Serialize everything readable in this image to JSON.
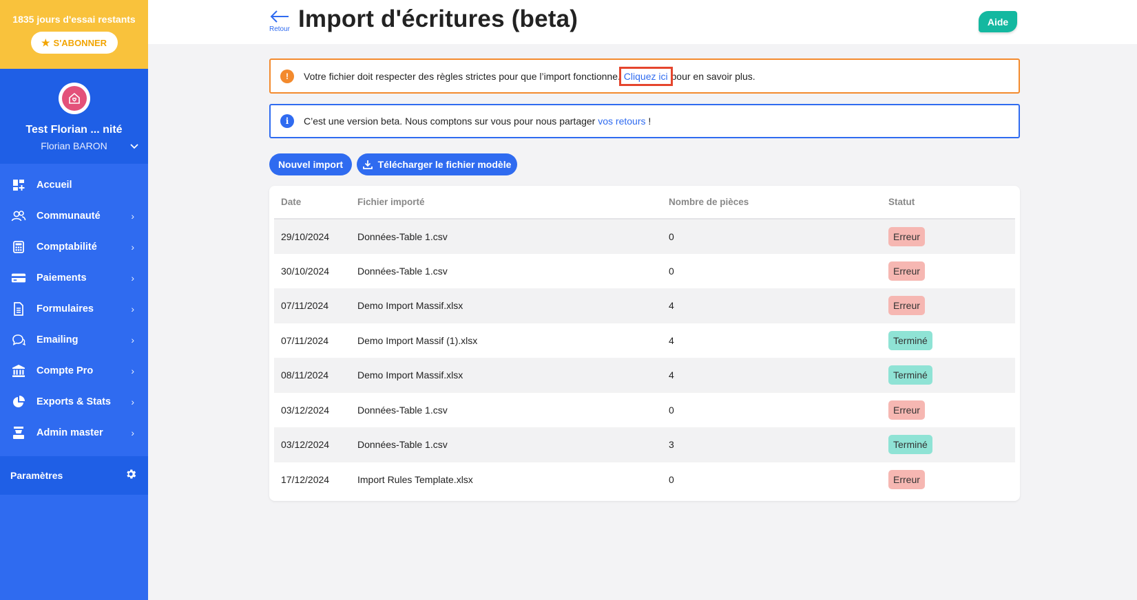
{
  "colors": {
    "primary": "#2f6bf0",
    "trial_bg": "#f9c23c",
    "help": "#14b8a0",
    "warning_border": "#f38a2d",
    "error_badge": "#f6b7b2",
    "success_badge": "#8fe3d5"
  },
  "sidebar": {
    "trial_text": "1835 jours d'essai restants",
    "subscribe_label": "S'ABONNER",
    "org_name": "Test Florian ... nité",
    "user_name": "Florian BARON",
    "items": [
      {
        "label": "Accueil",
        "icon": "dashboard-icon",
        "has_chevron": false
      },
      {
        "label": "Communauté",
        "icon": "people-icon",
        "has_chevron": true
      },
      {
        "label": "Comptabilité",
        "icon": "calculator-icon",
        "has_chevron": true
      },
      {
        "label": "Paiements",
        "icon": "credit-card-icon",
        "has_chevron": true
      },
      {
        "label": "Formulaires",
        "icon": "document-icon",
        "has_chevron": true
      },
      {
        "label": "Emailing",
        "icon": "chat-icon",
        "has_chevron": true
      },
      {
        "label": "Compte Pro",
        "icon": "bank-icon",
        "has_chevron": true
      },
      {
        "label": "Exports & Stats",
        "icon": "pie-chart-icon",
        "has_chevron": true
      },
      {
        "label": "Admin master",
        "icon": "admin-icon",
        "has_chevron": true
      }
    ],
    "settings_label": "Paramètres"
  },
  "header": {
    "back_label": "Retour",
    "title": "Import d'écritures (beta)",
    "help_label": "Aide"
  },
  "alerts": {
    "warning": {
      "icon": "!",
      "text_before": "Votre fichier doit respecter des règles strictes pour que l’import fonctionne. ",
      "link": "Cliquez ici",
      "text_after": " pour en savoir plus."
    },
    "info": {
      "icon": "i",
      "text_before": "C’est une version beta. Nous comptons sur vous pour nous partager ",
      "link": "vos retours",
      "text_after": " !"
    }
  },
  "actions": {
    "new_import": "Nouvel import",
    "download_template": "Télécharger le fichier modèle"
  },
  "table": {
    "headers": [
      "Date",
      "Fichier importé",
      "Nombre de pièces",
      "Statut"
    ],
    "rows": [
      {
        "date": "29/10/2024",
        "file": "Données-Table 1.csv",
        "pieces": "0",
        "status": "Erreur"
      },
      {
        "date": "30/10/2024",
        "file": "Données-Table 1.csv",
        "pieces": "0",
        "status": "Erreur"
      },
      {
        "date": "07/11/2024",
        "file": "Demo Import Massif.xlsx",
        "pieces": "4",
        "status": "Erreur"
      },
      {
        "date": "07/11/2024",
        "file": "Demo Import Massif (1).xlsx",
        "pieces": "4",
        "status": "Terminé"
      },
      {
        "date": "08/11/2024",
        "file": "Demo Import Massif.xlsx",
        "pieces": "4",
        "status": "Terminé"
      },
      {
        "date": "03/12/2024",
        "file": "Données-Table 1.csv",
        "pieces": "0",
        "status": "Erreur"
      },
      {
        "date": "03/12/2024",
        "file": "Données-Table 1.csv",
        "pieces": "3",
        "status": "Terminé"
      },
      {
        "date": "17/12/2024",
        "file": "Import Rules Template.xlsx",
        "pieces": "0",
        "status": "Erreur"
      }
    ]
  }
}
